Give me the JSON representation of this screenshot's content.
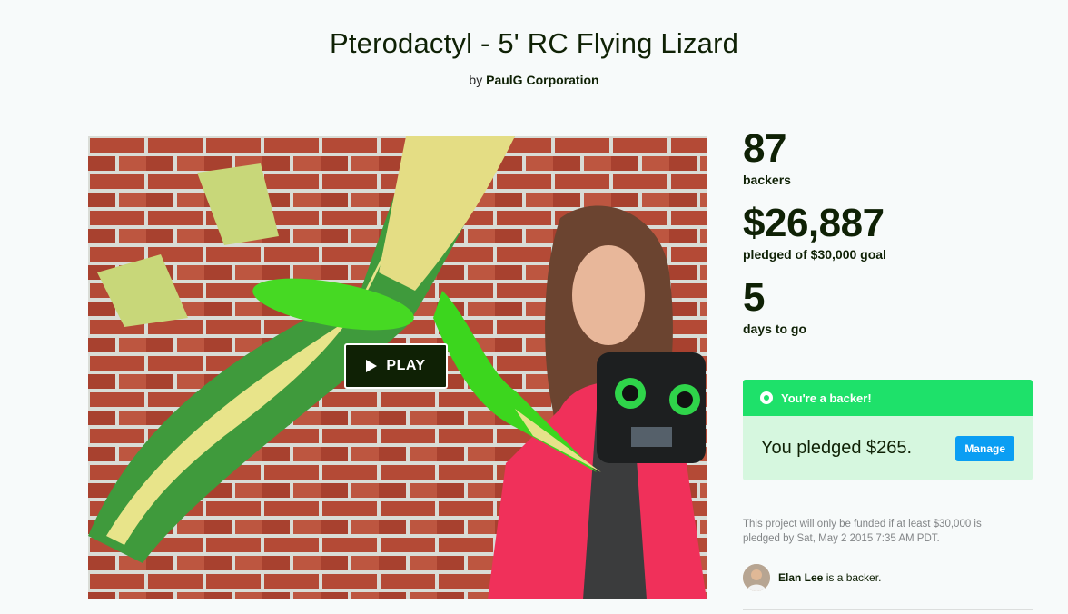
{
  "project": {
    "title": "Pterodactyl - 5' RC Flying Lizard",
    "by_prefix": "by",
    "creator": "PaulG Corporation"
  },
  "video": {
    "play_label": "PLAY",
    "play_icon": "play-triangle-icon"
  },
  "stats": {
    "backers_count": "87",
    "backers_label": "backers",
    "pledged_amount": "$26,887",
    "pledged_label": "pledged of $30,000 goal",
    "days_count": "5",
    "days_label": "days to go"
  },
  "backer_card": {
    "header": "You're a backer!",
    "header_icon": "backer-badge-icon",
    "pledge_text": "You pledged $265.",
    "manage_label": "Manage"
  },
  "funding_note": "This project will only be funded if at least $30,000 is pledged by Sat, May 2 2015 7:35 AM PDT.",
  "friend_backer": {
    "name": "Elan Lee",
    "suffix": "is a backer."
  },
  "colors": {
    "brand_green": "#1ee16a",
    "dark_text": "#0f2105",
    "card_bg": "#d6f7df",
    "manage_blue": "#0a9ef3"
  }
}
